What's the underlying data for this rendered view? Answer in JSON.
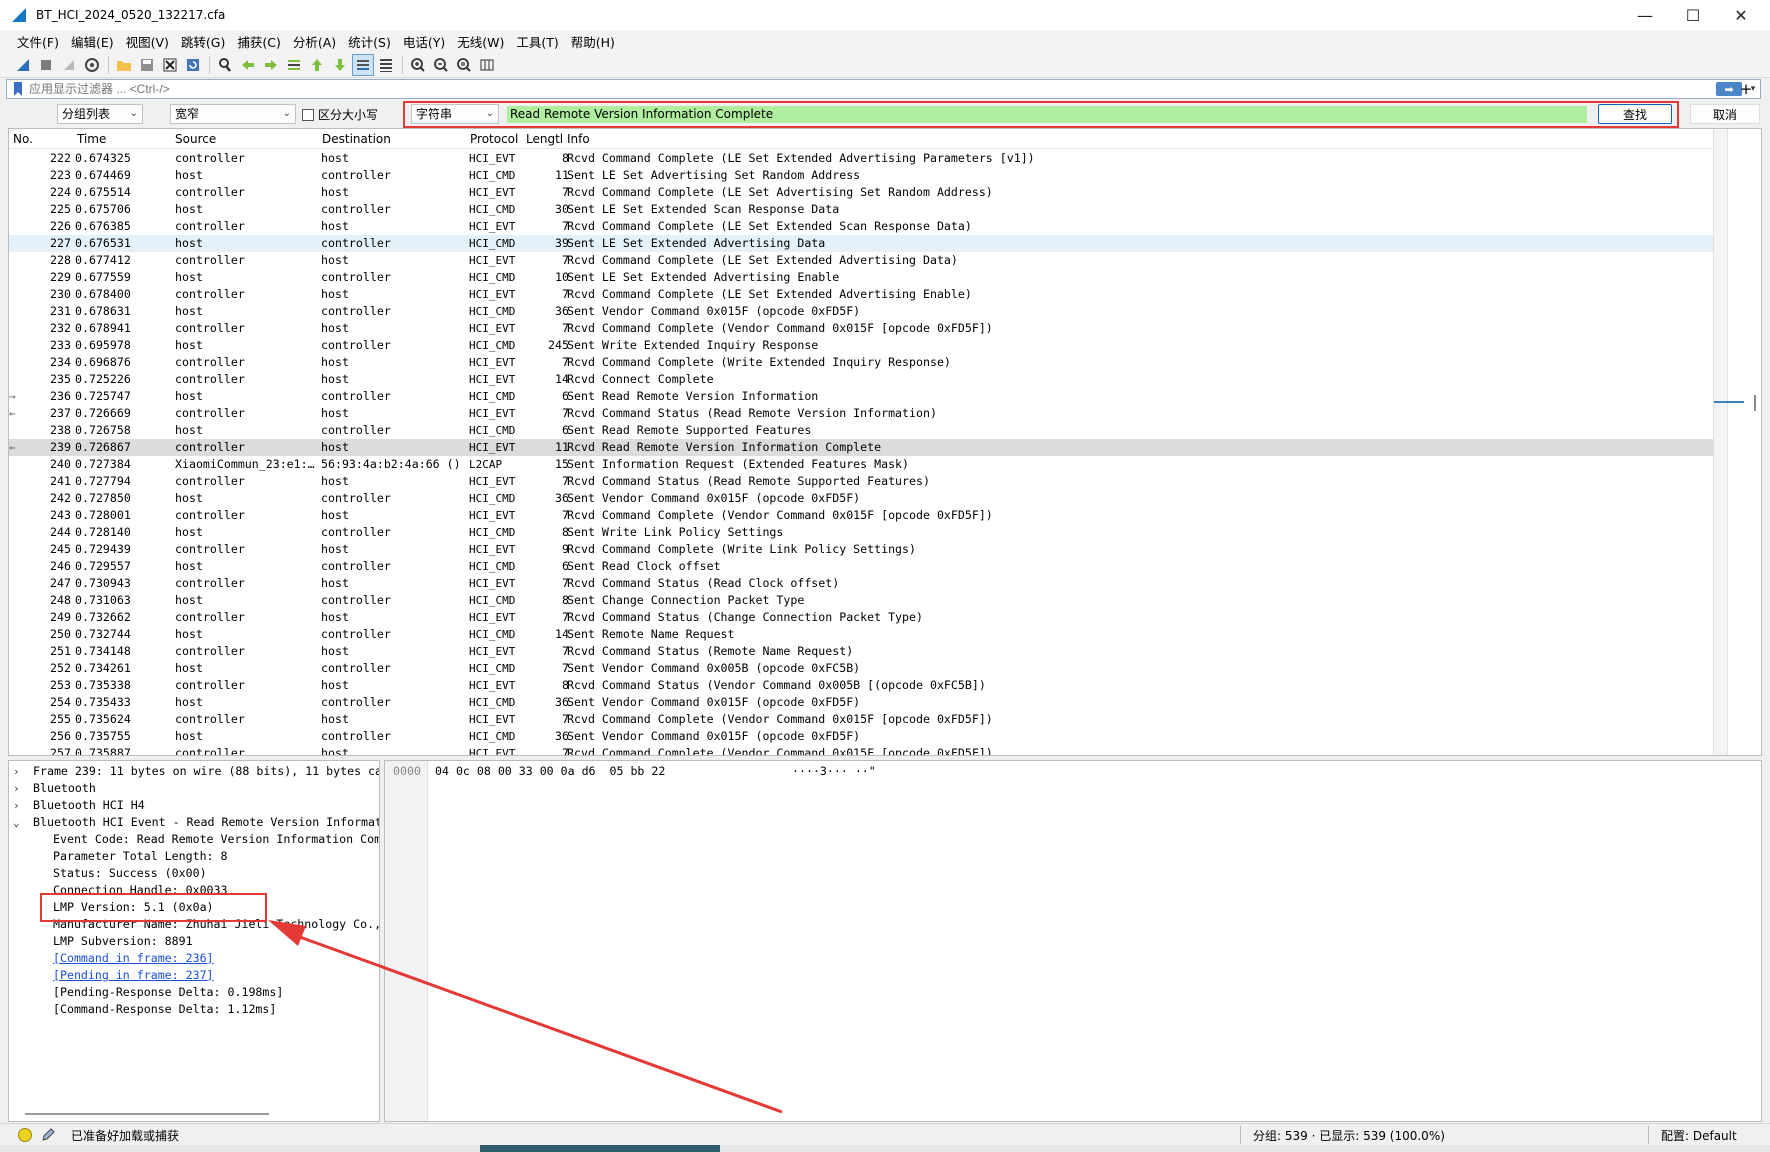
{
  "window": {
    "title": "BT_HCI_2024_0520_132217.cfa",
    "controls": {
      "minimize": "—",
      "maximize": "☐",
      "close": "✕"
    }
  },
  "menu": [
    "文件(F)",
    "编辑(E)",
    "视图(V)",
    "跳转(G)",
    "捕获(C)",
    "分析(A)",
    "统计(S)",
    "电话(Y)",
    "无线(W)",
    "工具(T)",
    "帮助(H)"
  ],
  "toolbar": {
    "icons": [
      "shark-fin-start-icon",
      "stop-icon",
      "restart-icon",
      "options-gear-icon",
      "open-folder-icon",
      "save-file-icon",
      "close-file-icon",
      "reload-icon",
      "find-magnifier-icon",
      "go-back-icon",
      "go-forward-icon",
      "go-to-packet-icon",
      "go-first-icon",
      "go-last-icon",
      "autoscroll-icon",
      "colorize-icon",
      "zoom-in-icon",
      "zoom-out-icon",
      "zoom-normal-icon",
      "resize-columns-icon"
    ]
  },
  "display_filter": {
    "placeholder": "应用显示过滤器 ... <Ctrl-/>",
    "apply_arrow": "➡",
    "dropdown": "▾",
    "add": "+"
  },
  "find_bar": {
    "search_in": "分组列表",
    "char_width": "宽窄",
    "case_sensitive_label": "区分大小写",
    "search_type": "字符串",
    "search_value": "Read Remote Version Information Complete",
    "find_button": "查找",
    "cancel_button": "取消"
  },
  "packet_list": {
    "columns": [
      "No.",
      "Time",
      "Source",
      "Destination",
      "Protocol",
      "Length",
      "Info"
    ],
    "columns_display": {
      "no": "No.",
      "time": "Time",
      "source": "Source",
      "destination": "Destination",
      "protocol": "Protocol",
      "length": "Lengtl",
      "info": "Info"
    },
    "rows": [
      {
        "no": "222",
        "time": "0.674325",
        "src": "controller",
        "dst": "host",
        "proto": "HCI_EVT",
        "len": "8",
        "info": "Rcvd Command Complete (LE Set Extended Advertising Parameters [v1])"
      },
      {
        "no": "223",
        "time": "0.674469",
        "src": "host",
        "dst": "controller",
        "proto": "HCI_CMD",
        "len": "11",
        "info": "Sent LE Set Advertising Set Random Address"
      },
      {
        "no": "224",
        "time": "0.675514",
        "src": "controller",
        "dst": "host",
        "proto": "HCI_EVT",
        "len": "7",
        "info": "Rcvd Command Complete (LE Set Advertising Set Random Address)"
      },
      {
        "no": "225",
        "time": "0.675706",
        "src": "host",
        "dst": "controller",
        "proto": "HCI_CMD",
        "len": "30",
        "info": "Sent LE Set Extended Scan Response Data"
      },
      {
        "no": "226",
        "time": "0.676385",
        "src": "controller",
        "dst": "host",
        "proto": "HCI_EVT",
        "len": "7",
        "info": "Rcvd Command Complete (LE Set Extended Scan Response Data)"
      },
      {
        "no": "227",
        "time": "0.676531",
        "src": "host",
        "dst": "controller",
        "proto": "HCI_CMD",
        "len": "39",
        "info": "Sent LE Set Extended Advertising Data",
        "hl": "light"
      },
      {
        "no": "228",
        "time": "0.677412",
        "src": "controller",
        "dst": "host",
        "proto": "HCI_EVT",
        "len": "7",
        "info": "Rcvd Command Complete (LE Set Extended Advertising Data)"
      },
      {
        "no": "229",
        "time": "0.677559",
        "src": "host",
        "dst": "controller",
        "proto": "HCI_CMD",
        "len": "10",
        "info": "Sent LE Set Extended Advertising Enable"
      },
      {
        "no": "230",
        "time": "0.678400",
        "src": "controller",
        "dst": "host",
        "proto": "HCI_EVT",
        "len": "7",
        "info": "Rcvd Command Complete (LE Set Extended Advertising Enable)"
      },
      {
        "no": "231",
        "time": "0.678631",
        "src": "host",
        "dst": "controller",
        "proto": "HCI_CMD",
        "len": "36",
        "info": "Sent Vendor Command 0x015F (opcode 0xFD5F)"
      },
      {
        "no": "232",
        "time": "0.678941",
        "src": "controller",
        "dst": "host",
        "proto": "HCI_EVT",
        "len": "7",
        "info": "Rcvd Command Complete (Vendor Command 0x015F [opcode 0xFD5F])"
      },
      {
        "no": "233",
        "time": "0.695978",
        "src": "host",
        "dst": "controller",
        "proto": "HCI_CMD",
        "len": "245",
        "info": "Sent Write Extended Inquiry Response"
      },
      {
        "no": "234",
        "time": "0.696876",
        "src": "controller",
        "dst": "host",
        "proto": "HCI_EVT",
        "len": "7",
        "info": "Rcvd Command Complete (Write Extended Inquiry Response)"
      },
      {
        "no": "235",
        "time": "0.725226",
        "src": "controller",
        "dst": "host",
        "proto": "HCI_EVT",
        "len": "14",
        "info": "Rcvd Connect Complete"
      },
      {
        "no": "236",
        "time": "0.725747",
        "src": "host",
        "dst": "controller",
        "proto": "HCI_CMD",
        "len": "6",
        "info": "Sent Read Remote Version Information",
        "mark": "→"
      },
      {
        "no": "237",
        "time": "0.726669",
        "src": "controller",
        "dst": "host",
        "proto": "HCI_EVT",
        "len": "7",
        "info": "Rcvd Command Status (Read Remote Version Information)",
        "mark": "←"
      },
      {
        "no": "238",
        "time": "0.726758",
        "src": "host",
        "dst": "controller",
        "proto": "HCI_CMD",
        "len": "6",
        "info": "Sent Read Remote Supported Features"
      },
      {
        "no": "239",
        "time": "0.726867",
        "src": "controller",
        "dst": "host",
        "proto": "HCI_EVT",
        "len": "11",
        "info": "Rcvd Read Remote Version Information Complete",
        "hl": "grey",
        "mark": "←"
      },
      {
        "no": "240",
        "time": "0.727384",
        "src": "XiaomiCommun_23:e1:…",
        "dst": "56:93:4a:b2:4a:66 ()",
        "proto": "L2CAP",
        "len": "15",
        "info": "Sent Information Request (Extended Features Mask)"
      },
      {
        "no": "241",
        "time": "0.727794",
        "src": "controller",
        "dst": "host",
        "proto": "HCI_EVT",
        "len": "7",
        "info": "Rcvd Command Status (Read Remote Supported Features)"
      },
      {
        "no": "242",
        "time": "0.727850",
        "src": "host",
        "dst": "controller",
        "proto": "HCI_CMD",
        "len": "36",
        "info": "Sent Vendor Command 0x015F (opcode 0xFD5F)"
      },
      {
        "no": "243",
        "time": "0.728001",
        "src": "controller",
        "dst": "host",
        "proto": "HCI_EVT",
        "len": "7",
        "info": "Rcvd Command Complete (Vendor Command 0x015F [opcode 0xFD5F])"
      },
      {
        "no": "244",
        "time": "0.728140",
        "src": "host",
        "dst": "controller",
        "proto": "HCI_CMD",
        "len": "8",
        "info": "Sent Write Link Policy Settings"
      },
      {
        "no": "245",
        "time": "0.729439",
        "src": "controller",
        "dst": "host",
        "proto": "HCI_EVT",
        "len": "9",
        "info": "Rcvd Command Complete (Write Link Policy Settings)"
      },
      {
        "no": "246",
        "time": "0.729557",
        "src": "host",
        "dst": "controller",
        "proto": "HCI_CMD",
        "len": "6",
        "info": "Sent Read Clock offset"
      },
      {
        "no": "247",
        "time": "0.730943",
        "src": "controller",
        "dst": "host",
        "proto": "HCI_EVT",
        "len": "7",
        "info": "Rcvd Command Status (Read Clock offset)"
      },
      {
        "no": "248",
        "time": "0.731063",
        "src": "host",
        "dst": "controller",
        "proto": "HCI_CMD",
        "len": "8",
        "info": "Sent Change Connection Packet Type"
      },
      {
        "no": "249",
        "time": "0.732662",
        "src": "controller",
        "dst": "host",
        "proto": "HCI_EVT",
        "len": "7",
        "info": "Rcvd Command Status (Change Connection Packet Type)"
      },
      {
        "no": "250",
        "time": "0.732744",
        "src": "host",
        "dst": "controller",
        "proto": "HCI_CMD",
        "len": "14",
        "info": "Sent Remote Name Request"
      },
      {
        "no": "251",
        "time": "0.734148",
        "src": "controller",
        "dst": "host",
        "proto": "HCI_EVT",
        "len": "7",
        "info": "Rcvd Command Status (Remote Name Request)"
      },
      {
        "no": "252",
        "time": "0.734261",
        "src": "host",
        "dst": "controller",
        "proto": "HCI_CMD",
        "len": "7",
        "info": "Sent Vendor Command 0x005B (opcode 0xFC5B)"
      },
      {
        "no": "253",
        "time": "0.735338",
        "src": "controller",
        "dst": "host",
        "proto": "HCI_EVT",
        "len": "8",
        "info": "Rcvd Command Status (Vendor Command 0x005B [(opcode 0xFC5B])"
      },
      {
        "no": "254",
        "time": "0.735433",
        "src": "host",
        "dst": "controller",
        "proto": "HCI_CMD",
        "len": "36",
        "info": "Sent Vendor Command 0x015F (opcode 0xFD5F)"
      },
      {
        "no": "255",
        "time": "0.735624",
        "src": "controller",
        "dst": "host",
        "proto": "HCI_EVT",
        "len": "7",
        "info": "Rcvd Command Complete (Vendor Command 0x015F [opcode 0xFD5F])"
      },
      {
        "no": "256",
        "time": "0.735755",
        "src": "host",
        "dst": "controller",
        "proto": "HCI_CMD",
        "len": "36",
        "info": "Sent Vendor Command 0x015F (opcode 0xFD5F)"
      },
      {
        "no": "257",
        "time": "0.735887",
        "src": "controller",
        "dst": "host",
        "proto": "HCI_EVT",
        "len": "7",
        "info": "Rcvd Command Complete (Vendor Command 0x015F [opcode 0xFD5F])"
      }
    ]
  },
  "packet_details": [
    {
      "text": "Frame 239: 11 bytes on wire (88 bits), 11 bytes ca",
      "arrow": "›",
      "level": 0
    },
    {
      "text": "Bluetooth",
      "arrow": "›",
      "level": 0
    },
    {
      "text": "Bluetooth HCI H4",
      "arrow": "›",
      "level": 0
    },
    {
      "text": "Bluetooth HCI Event - Read Remote Version Informat",
      "arrow": "⌄",
      "level": 0
    },
    {
      "text": "Event Code: Read Remote Version Information Com",
      "level": 1
    },
    {
      "text": "Parameter Total Length: 8",
      "level": 1
    },
    {
      "text": "Status: Success (0x00)",
      "level": 1
    },
    {
      "text": "Connection Handle: 0x0033",
      "level": 1
    },
    {
      "text": "LMP Version: 5.1 (0x0a)",
      "level": 1
    },
    {
      "text": "Manufacturer Name: Zhuhai Jieli Technology Co.,",
      "level": 1
    },
    {
      "text": "LMP Subversion: 8891",
      "level": 1
    },
    {
      "text": "[Command in frame: 236]",
      "level": 1,
      "link": true
    },
    {
      "text": "[Pending in frame: 237]",
      "level": 1,
      "link": true
    },
    {
      "text": "[Pending-Response Delta: 0.198ms]",
      "level": 1
    },
    {
      "text": "[Command-Response Delta: 1.12ms]",
      "level": 1
    }
  ],
  "packet_bytes": {
    "offset": "0000",
    "hex": "04 0c 08 00 33 00 0a d6  05 bb 22",
    "ascii": "····3··· ··\""
  },
  "status": {
    "ready_text": "已准备好加载或捕获",
    "packets_text": "分组: 539 · 已显示: 539 (100.0%)",
    "profile_text": "配置: Default"
  },
  "colors": {
    "find_highlight": "#afee9e",
    "annotation_red": "#e53935",
    "selected_light": "#e4f1fb",
    "selected_grey": "#dcdcdc",
    "link_blue": "#1a4fd6"
  }
}
